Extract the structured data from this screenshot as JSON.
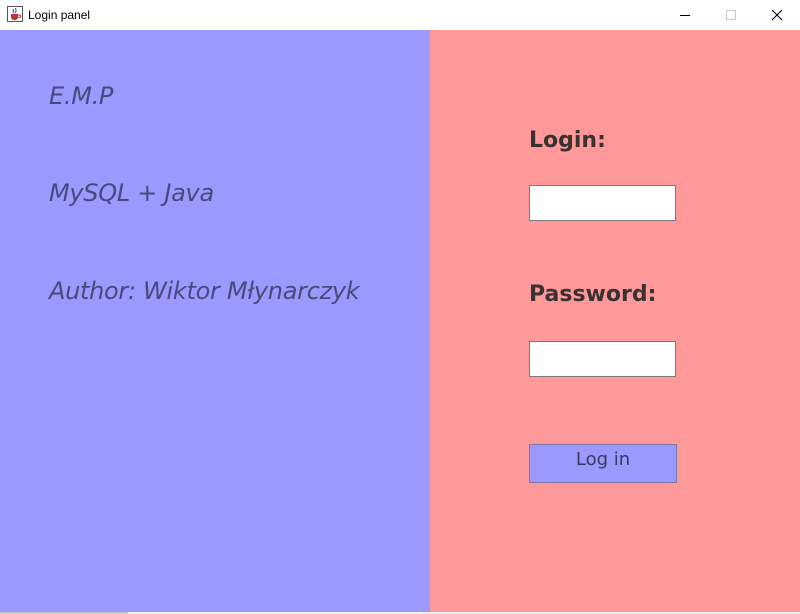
{
  "window": {
    "title": "Login panel",
    "icon": "java-cup-icon",
    "controls": [
      "minimize-icon",
      "maximize-icon",
      "close-icon"
    ]
  },
  "left_panel": {
    "background": "#9999ff",
    "line1": "E.M.P",
    "line2": "MySQL + Java",
    "line3": "Author: Wiktor Młynarczyk"
  },
  "right_panel": {
    "background": "#ff9999",
    "login_label": "Login:",
    "login_value": "",
    "password_label": "Password:",
    "password_value": "",
    "button_label": "Log in",
    "button_color": "#9999ff"
  }
}
